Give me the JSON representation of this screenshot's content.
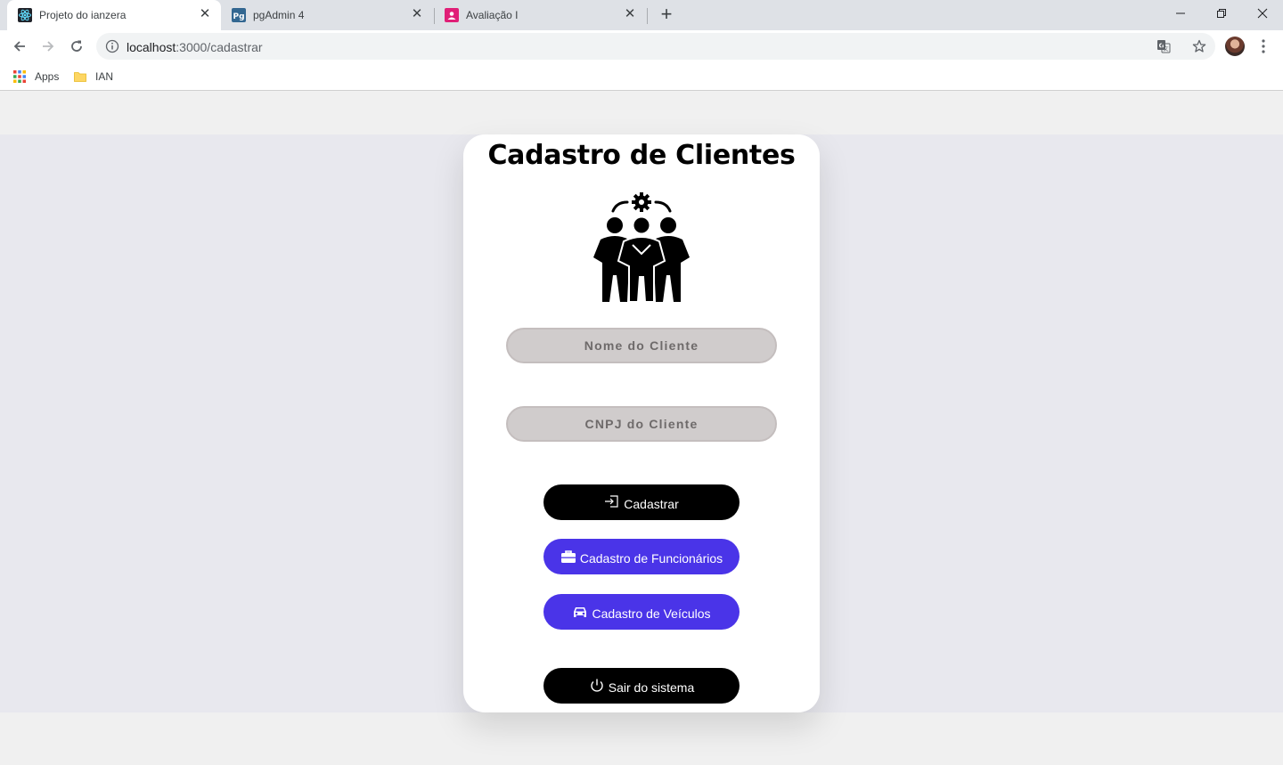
{
  "browser": {
    "tabs": [
      {
        "title": "Projeto do ianzera",
        "active": true,
        "favicon": "react-icon"
      },
      {
        "title": "pgAdmin 4",
        "active": false,
        "favicon": "pgadmin-icon"
      },
      {
        "title": "Avaliação I",
        "active": false,
        "favicon": "classroom-icon"
      }
    ],
    "url_host": "localhost",
    "url_path": ":3000/cadastrar",
    "bookmarks": [
      {
        "label": "Apps",
        "icon": "apps-grid-icon"
      },
      {
        "label": "IAN",
        "icon": "folder-icon"
      }
    ]
  },
  "page": {
    "title": "Cadastro de Clientes",
    "icon": "team-gear-icon",
    "fields": {
      "nome_placeholder": "Nome do Cliente",
      "nome_value": "",
      "cnpj_placeholder": "CNPJ do Cliente",
      "cnpj_value": ""
    },
    "buttons": {
      "cadastrar": "Cadastrar",
      "funcionarios": "Cadastro de Funcionários",
      "veiculos": "Cadastro de Veículos",
      "sair": "Sair do sistema"
    }
  },
  "colors": {
    "primary_blue": "#4a34e8",
    "dark_button": "#000000",
    "field_bg": "#d0cccc",
    "card_bg": "#ffffff"
  }
}
